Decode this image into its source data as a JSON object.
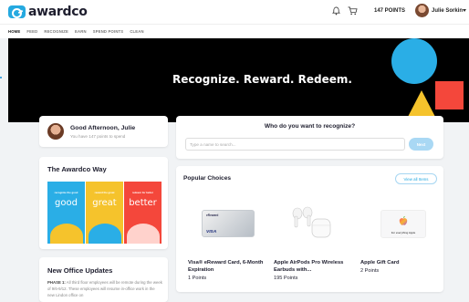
{
  "app": {
    "brand": "awardco",
    "points_label": "147 POINTS",
    "user_name": "Julie Sorkin"
  },
  "nav": {
    "items": [
      "HOME",
      "FEED",
      "RECOGNIZE",
      "EARN",
      "SPEND POINTS",
      "CLEAN"
    ],
    "active": "HOME"
  },
  "hero": {
    "title": "Recognize. Reward. Redeem."
  },
  "greeting": {
    "title": "Good Afternoon, Julie",
    "subtitle": "You have 147 points to spend"
  },
  "recognize": {
    "title": "Who do you want to recognize?",
    "placeholder": "Type a name to search...",
    "send_label": "Next"
  },
  "awardco_way": {
    "title": "The Awardco Way",
    "tiles": [
      {
        "word": "good",
        "caption": "recognize the good",
        "color": "#2aaee6"
      },
      {
        "word": "great",
        "caption": "reward the great",
        "color": "#f5c32c"
      },
      {
        "word": "better",
        "caption": "redeem for better",
        "color": "#f4473b"
      }
    ]
  },
  "popular": {
    "title": "Popular Choices",
    "view_all_label": "View all Items",
    "products": [
      {
        "name": "Visa® eReward Card, 6-Month Expiration",
        "points": "1 Points",
        "card_top": "eReward",
        "card_brand": "VISA"
      },
      {
        "name": "Apple AirPods Pro Wireless Earbuds with...",
        "points": "195 Points"
      },
      {
        "name": "Apple Gift Card",
        "points": "2 Points",
        "card_text": "For everything Apple"
      }
    ]
  },
  "office": {
    "title": "New Office Updates",
    "lead": "PHASE 1:",
    "body": "All third floor employees will be remote during the week of 9/6-9/12. These employees will resume in-office work in the new Lindon office on"
  },
  "colors": {
    "accent": "#25a9e0",
    "hero_bg": "#000000",
    "blue": "#2aaee6",
    "yellow": "#f5c32c",
    "red": "#f4473b"
  }
}
